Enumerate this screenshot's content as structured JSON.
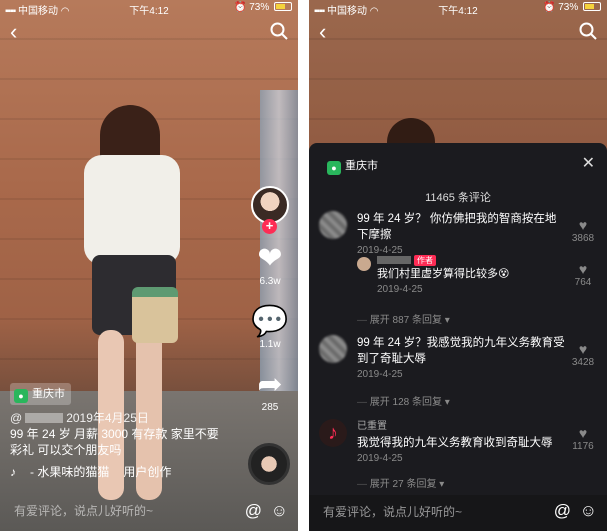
{
  "status_bar": {
    "carrier": "中国移动",
    "time": "下午4:12",
    "battery": "73%"
  },
  "icons": {
    "back": "chevron-left-icon",
    "search": "search-icon",
    "like": "heart-icon",
    "comment": "comment-bubble-icon",
    "share": "share-arrow-icon",
    "music": "music-note-icon",
    "at": "at-icon",
    "emoji": "emoji-icon",
    "close": "close-icon",
    "location": "location-pin-icon"
  },
  "colors": {
    "accent": "#fe2c55",
    "location_green": "#29b65c",
    "panel_bg": "#1b1b1f"
  },
  "video": {
    "location": "重庆市",
    "handle_prefix": "@",
    "date": "2019年4月25日",
    "caption_line1": "99 年 24 岁 月薪 3000 有存款 家里不要",
    "caption_line2": "彩礼 可以交个朋友吗",
    "music_title": "- 水果味的猫猫",
    "music_suffix": "用户创作",
    "likes": "6.3w",
    "comments": "1.1w",
    "shares": "285"
  },
  "comment_input": {
    "placeholder": "有爱评论，说点儿好听的~"
  },
  "comments_panel": {
    "location": "重庆市",
    "count_label": "11465 条评论",
    "comments": [
      {
        "text": "99 年 24 岁？ 你仿佛把我的智商按在地下摩擦",
        "date": "2019-4-25",
        "likes": "3868"
      },
      {
        "text": "99 年 24 岁？我感觉我的九年义务教育受到了奇耻大辱",
        "date": "2019-4-25",
        "likes": "3428"
      },
      {
        "name": "已重置",
        "text": "我觉得我的九年义务教育收到奇耻大辱",
        "date": "2019-4-25",
        "likes": "1176"
      }
    ],
    "reply": {
      "badge": "作者",
      "text": "我们村里虚岁算得比较多",
      "emoji": "😵",
      "date": "2019-4-25",
      "likes": "764"
    },
    "expand_1": "展开 887 条回复",
    "expand_2": "展开 128 条回复",
    "expand_3": "展开 27 条回复"
  }
}
